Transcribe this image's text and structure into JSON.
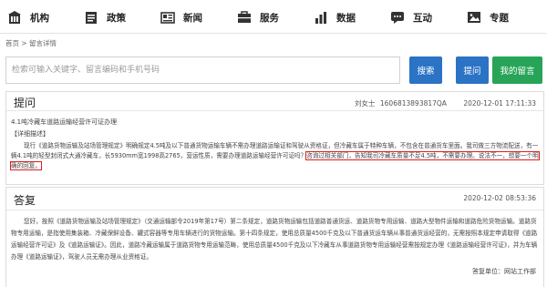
{
  "nav": {
    "items": [
      {
        "label": "机构",
        "icon": "building-icon"
      },
      {
        "label": "政策",
        "icon": "document-icon"
      },
      {
        "label": "新闻",
        "icon": "newspaper-icon"
      },
      {
        "label": "服务",
        "icon": "service-icon"
      },
      {
        "label": "数据",
        "icon": "chart-icon"
      },
      {
        "label": "互动",
        "icon": "chat-icon"
      },
      {
        "label": "专题",
        "icon": "image-icon"
      }
    ]
  },
  "breadcrumb": "首页 > 留言详情",
  "search": {
    "placeholder": "检索可输入关键字、留言编码和手机号码",
    "search_label": "搜索",
    "ask_label": "提问",
    "mine_label": "我的留言"
  },
  "question": {
    "heading": "提问",
    "author": "刘女士",
    "code": "1606813893817QA",
    "datetime": "2020-12-01 17:11:33",
    "subject": "4.1吨冷藏车道路运输经营许可证办理",
    "section_label": "【详细描述】",
    "body": "现行《道路货物运输及站场管理规定》明确规定4.5吨及以下普通货物运输车辆不需办理道路运输证和驾驶从资格证，但冷藏车属于特种车辆，不包含在普通货车里面。我司做三方物流配送，有一辆4.1吨的轻型封闭式大通冷藏车，长5930mm宽1998高2765，营运性质，需要办理道路运输经营许可证吗？",
    "highlight": "咨询过相关部门，告知我司冷藏车质量不足4.5吨，不需要办理。说法不一，想要一个明确的回复。"
  },
  "answer": {
    "heading": "答复",
    "date": "2020-12-02 08:53:36",
    "body": "您好，按照《道路货物运输及站场管理规定》（交通运输部令2019年第17号）第二条规定，道路货物运输包括道路普通货运、道路货物专用运输、道路大型物件运输和道路危险货物运输。道路货物专用运输，是指使用集装箱、冷藏保鲜设备、罐式容器等专用车辆进行的货物运输。第十四条规定，使用总质量4500千克及以下普通货运车辆从事普通货运经营的，无需按照本规定申请取得《道路运输经营许可证》及《道路运输证》。因此，道路冷藏运输属于道路货物专用运输范畴，使用总质量4500千克及以下冷藏车从事道路货物专用运输经营需按规定办理《道路运输经营许可证》，并为车辆办理《道路运输证》，驾驶人员无需办理从业资格证。",
    "signature": "答复单位：网站工作部"
  }
}
